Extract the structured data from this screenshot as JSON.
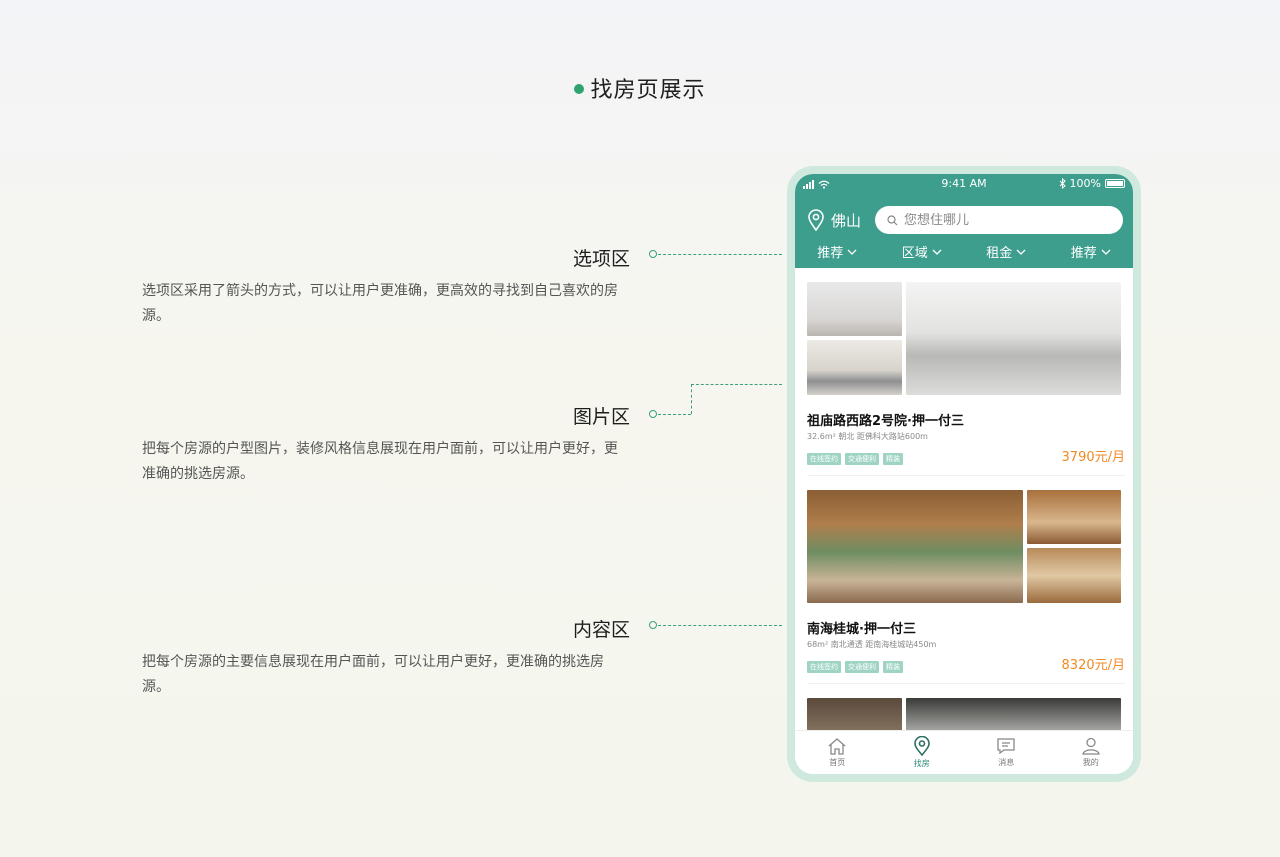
{
  "page": {
    "title": "找房页展示"
  },
  "colors": {
    "accent": "#3e9e8e",
    "price": "#f08a24",
    "dot": "#2fa36f"
  },
  "sections": [
    {
      "heading": "选项区",
      "desc": "选项区采用了箭头的方式，可以让用户更准确，更高效的寻找到自己喜欢的房源。"
    },
    {
      "heading": "图片区",
      "desc": "把每个房源的户型图片，装修风格信息展现在用户面前，可以让用户更好，更准确的挑选房源。"
    },
    {
      "heading": "内容区",
      "desc": "把每个房源的主要信息展现在用户面前，可以让用户更好，更准确的挑选房源。"
    }
  ],
  "phone": {
    "status": {
      "time": "9:41 AM",
      "battery": "100%"
    },
    "city": "佛山",
    "search": {
      "placeholder": "您想住哪儿"
    },
    "filters": [
      "推荐",
      "区域",
      "租金",
      "推荐"
    ],
    "listings": [
      {
        "title": "祖庙路西路2号院·押一付三",
        "meta": "32.6m² 朝北 距佛科大路站600m",
        "tags": [
          "在线签约",
          "交通便利",
          "精装"
        ],
        "price": "3790元/月"
      },
      {
        "title": "南海桂城·押一付三",
        "meta": "68m² 南北通透 距南海桂城站450m",
        "tags": [
          "在线签约",
          "交通便利",
          "精装"
        ],
        "price": "8320元/月"
      }
    ],
    "tabs": [
      {
        "label": "首页",
        "icon": "home-icon"
      },
      {
        "label": "找房",
        "icon": "location-pin-icon"
      },
      {
        "label": "消息",
        "icon": "message-icon"
      },
      {
        "label": "我的",
        "icon": "user-icon"
      }
    ]
  }
}
